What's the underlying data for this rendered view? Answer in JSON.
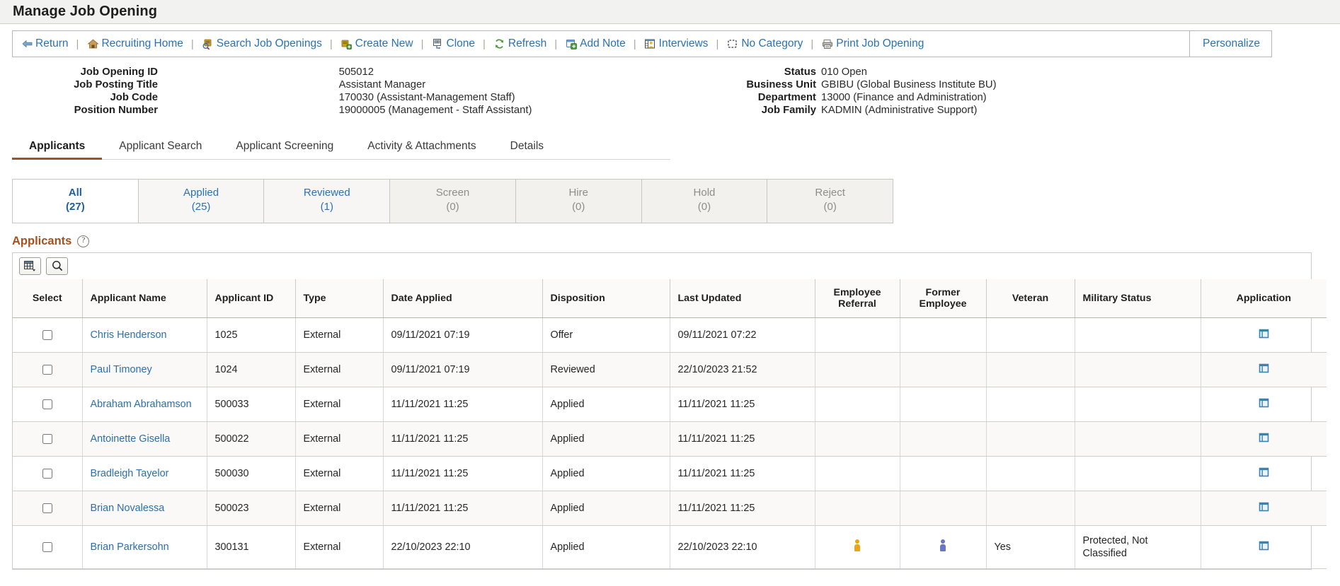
{
  "page": {
    "title": "Manage Job Opening"
  },
  "toolbar": {
    "items": [
      {
        "label": "Return",
        "icon": "back-arrow-icon"
      },
      {
        "label": "Recruiting Home",
        "icon": "home-icon"
      },
      {
        "label": "Search Job Openings",
        "icon": "search-jobs-icon"
      },
      {
        "label": "Create New",
        "icon": "create-new-icon"
      },
      {
        "label": "Clone",
        "icon": "clone-icon"
      },
      {
        "label": "Refresh",
        "icon": "refresh-icon"
      },
      {
        "label": "Add Note",
        "icon": "add-note-icon"
      },
      {
        "label": "Interviews",
        "icon": "interviews-icon"
      },
      {
        "label": "No Category",
        "icon": "no-category-icon"
      },
      {
        "label": "Print Job Opening",
        "icon": "printer-icon"
      }
    ],
    "separator": "|",
    "personalize_label": "Personalize"
  },
  "header_facts": {
    "left": [
      {
        "label": "Job Opening ID",
        "value": "505012"
      },
      {
        "label": "Job Posting Title",
        "value": "Assistant Manager"
      },
      {
        "label": "Job Code",
        "value": "170030 (Assistant-Management Staff)"
      },
      {
        "label": "Position Number",
        "value": "19000005 (Management - Staff Assistant)"
      }
    ],
    "right": [
      {
        "label": "Status",
        "value": "010 Open"
      },
      {
        "label": "Business Unit",
        "value": "GBIBU (Global Business Institute BU)"
      },
      {
        "label": "Department",
        "value": "13000 (Finance and Administration)"
      },
      {
        "label": "Job Family",
        "value": "KADMIN (Administrative Support)"
      }
    ]
  },
  "main_tabs": [
    {
      "label": "Applicants",
      "active": true
    },
    {
      "label": "Applicant Search",
      "active": false
    },
    {
      "label": "Applicant Screening",
      "active": false
    },
    {
      "label": "Activity & Attachments",
      "active": false
    },
    {
      "label": "Details",
      "active": false
    }
  ],
  "status_tabs": [
    {
      "label": "All",
      "count": "(27)",
      "state": "active"
    },
    {
      "label": "Applied",
      "count": "(25)",
      "state": "enabled"
    },
    {
      "label": "Reviewed",
      "count": "(1)",
      "state": "enabled"
    },
    {
      "label": "Screen",
      "count": "(0)",
      "state": "disabled"
    },
    {
      "label": "Hire",
      "count": "(0)",
      "state": "disabled"
    },
    {
      "label": "Hold",
      "count": "(0)",
      "state": "disabled"
    },
    {
      "label": "Reject",
      "count": "(0)",
      "state": "disabled"
    }
  ],
  "grid": {
    "title": "Applicants",
    "help_glyph": "?",
    "buttons": [
      {
        "name": "personalize-grid-button",
        "icon": "grid-settings-icon"
      },
      {
        "name": "find-button",
        "icon": "search-icon"
      }
    ],
    "columns": [
      "Select",
      "Applicant Name",
      "Applicant ID",
      "Type",
      "Date Applied",
      "Disposition",
      "Last Updated",
      "Employee Referral",
      "Former Employee",
      "Veteran",
      "Military Status",
      "Application"
    ],
    "rows": [
      {
        "select": false,
        "name": "Chris Henderson",
        "id": "1025",
        "type": "External",
        "date_applied": "09/11/2021 07:19",
        "disposition": "Offer",
        "last_updated": "09/11/2021 07:22",
        "employee_referral": "",
        "former_employee": "",
        "veteran": "",
        "military_status": "",
        "application_icon": "application-window-icon"
      },
      {
        "select": false,
        "name": "Paul Timoney",
        "id": "1024",
        "type": "External",
        "date_applied": "09/11/2021 07:19",
        "disposition": "Reviewed",
        "last_updated": "22/10/2023 21:52",
        "employee_referral": "",
        "former_employee": "",
        "veteran": "",
        "military_status": "",
        "application_icon": "application-window-icon"
      },
      {
        "select": false,
        "name": "Abraham Abrahamson",
        "id": "500033",
        "type": "External",
        "date_applied": "11/11/2021 11:25",
        "disposition": "Applied",
        "last_updated": "11/11/2021 11:25",
        "employee_referral": "",
        "former_employee": "",
        "veteran": "",
        "military_status": "",
        "application_icon": "application-window-icon"
      },
      {
        "select": false,
        "name": "Antoinette Gisella",
        "id": "500022",
        "type": "External",
        "date_applied": "11/11/2021 11:25",
        "disposition": "Applied",
        "last_updated": "11/11/2021 11:25",
        "employee_referral": "",
        "former_employee": "",
        "veteran": "",
        "military_status": "",
        "application_icon": "application-window-icon"
      },
      {
        "select": false,
        "name": "Bradleigh Tayelor",
        "id": "500030",
        "type": "External",
        "date_applied": "11/11/2021 11:25",
        "disposition": "Applied",
        "last_updated": "11/11/2021 11:25",
        "employee_referral": "",
        "former_employee": "",
        "veteran": "",
        "military_status": "",
        "application_icon": "application-window-icon"
      },
      {
        "select": false,
        "name": "Brian Novalessa",
        "id": "500023",
        "type": "External",
        "date_applied": "11/11/2021 11:25",
        "disposition": "Applied",
        "last_updated": "11/11/2021 11:25",
        "employee_referral": "",
        "former_employee": "",
        "veteran": "",
        "military_status": "",
        "application_icon": "application-window-icon"
      },
      {
        "select": false,
        "name": "Brian Parkersohn",
        "id": "300131",
        "type": "External",
        "date_applied": "22/10/2023 22:10",
        "disposition": "Applied",
        "last_updated": "22/10/2023 22:10",
        "employee_referral": "referral-person-icon",
        "former_employee": "former-employee-person-icon",
        "veteran": "Yes",
        "military_status": "Protected, Not Classified",
        "application_icon": "application-window-icon"
      }
    ]
  },
  "colors": {
    "link": "#2a72b5",
    "accent": "#a35121",
    "title_bar": "#f2f2f0",
    "icon_gold": "#e8a712",
    "icon_blue": "#6b76c4",
    "app_icon": "#3a83ad"
  }
}
